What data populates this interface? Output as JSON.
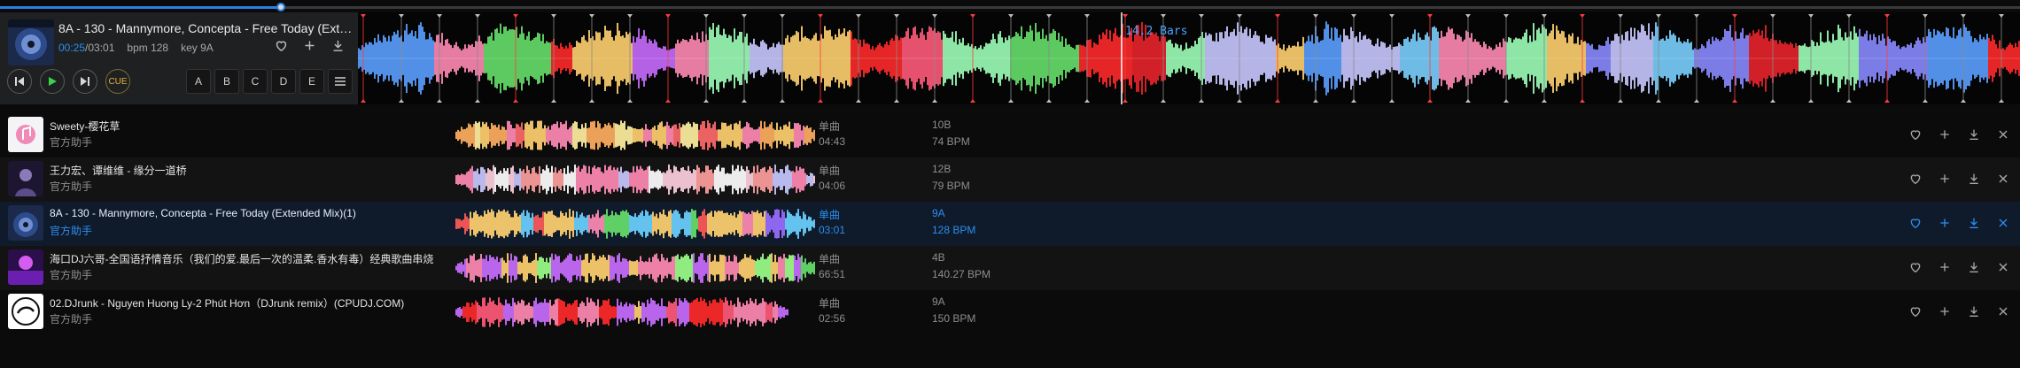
{
  "progress": {
    "fraction": 0.139
  },
  "now_playing": {
    "title": "8A - 130 - Mannymore, Concepta - Free Today (Exte...",
    "current_time": "00:25",
    "total_time": "/03:01",
    "bpm_text": "bpm 128",
    "key_text": "key 9A",
    "cover_icon": "album-cover-disc"
  },
  "transport": {
    "prev_icon": "skip-previous-icon",
    "play_icon": "play-icon",
    "next_icon": "skip-next-icon",
    "cue_label": "CUE"
  },
  "hotcues": [
    "A",
    "B",
    "C",
    "D",
    "E"
  ],
  "waveform": {
    "bars_label": "14.2 Bars"
  },
  "colors": {
    "accent": "#2b8ff0",
    "play": "#3bd14b",
    "cue": "#e2b43a"
  },
  "tracks": [
    {
      "title": "Sweety-樱花草",
      "artist": "官方助手",
      "type": "单曲",
      "duration": "04:43",
      "key": "10B",
      "bpm": "74 BPM",
      "active": false
    },
    {
      "title": "王力宏、谭维维 - 缘分一道桥",
      "artist": "官方助手",
      "type": "单曲",
      "duration": "04:06",
      "key": "12B",
      "bpm": "79 BPM",
      "active": false
    },
    {
      "title": "8A - 130 - Mannymore, Concepta - Free Today (Extended Mix)(1)",
      "artist": "官方助手",
      "type": "单曲",
      "duration": "03:01",
      "key": "9A",
      "bpm": "128 BPM",
      "active": true
    },
    {
      "title": "海口DJ六哥-全国语抒情音乐（我们的爱.最后一次的温柔.香水有毒）经典歌曲串烧",
      "artist": "官方助手",
      "type": "单曲",
      "duration": "66:51",
      "key": "4B",
      "bpm": "140.27 BPM",
      "active": false
    },
    {
      "title": "02.DJrunk - Nguyen Huong Ly-2 Phút Hơn（DJrunk remix）(CPUDJ.COM)",
      "artist": "官方助手",
      "type": "单曲",
      "duration": "02:56",
      "key": "9A",
      "bpm": "150 BPM",
      "active": false
    }
  ]
}
